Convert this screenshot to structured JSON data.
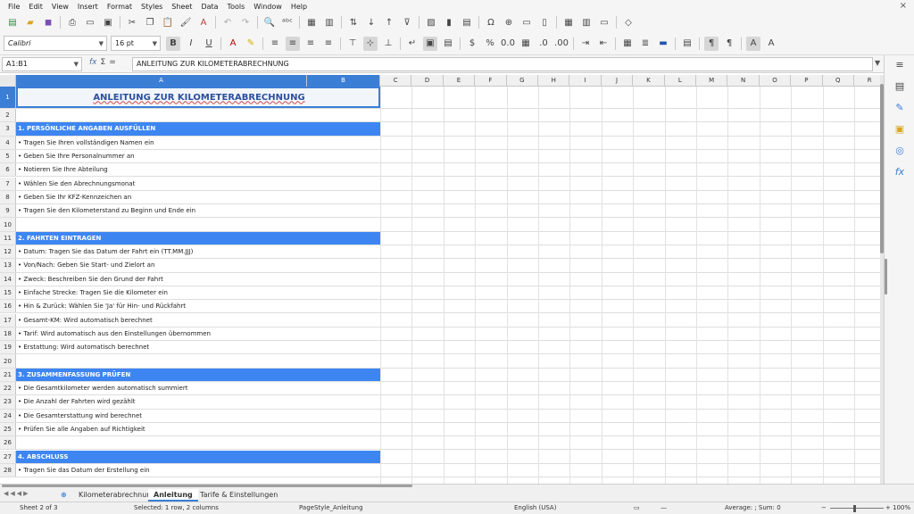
{
  "menu": [
    "File",
    "Edit",
    "View",
    "Insert",
    "Format",
    "Styles",
    "Sheet",
    "Data",
    "Tools",
    "Window",
    "Help"
  ],
  "format_toolbar": {
    "font_name": "Calibri",
    "font_size": "16 pt"
  },
  "formula_bar": {
    "name_box": "A1:B1",
    "content": "ANLEITUNG ZUR KILOMETERABRECHNUNG"
  },
  "columns": [
    "A",
    "B",
    "C",
    "D",
    "E",
    "F",
    "G",
    "H",
    "I",
    "J",
    "K",
    "L",
    "M",
    "N",
    "O",
    "P",
    "Q",
    "R"
  ],
  "rows": [
    {
      "n": "1",
      "text": "ANLEITUNG ZUR KILOMETERABRECHNUNG",
      "kind": "title"
    },
    {
      "n": "2",
      "text": "",
      "kind": "blank"
    },
    {
      "n": "3",
      "text": "1. PERSÖNLICHE ANGABEN AUSFÜLLEN",
      "kind": "section"
    },
    {
      "n": "4",
      "text": "• Tragen Sie Ihren vollständigen Namen ein",
      "kind": "item"
    },
    {
      "n": "5",
      "text": "• Geben Sie Ihre Personalnummer an",
      "kind": "item"
    },
    {
      "n": "6",
      "text": "• Notieren Sie Ihre Abteilung",
      "kind": "item"
    },
    {
      "n": "7",
      "text": "• Wählen Sie den Abrechnungsmonat",
      "kind": "item"
    },
    {
      "n": "8",
      "text": "• Geben Sie Ihr KFZ-Kennzeichen an",
      "kind": "item"
    },
    {
      "n": "9",
      "text": "• Tragen Sie den Kilometerstand zu Beginn und Ende ein",
      "kind": "item"
    },
    {
      "n": "10",
      "text": "",
      "kind": "blank"
    },
    {
      "n": "11",
      "text": "2. FAHRTEN EINTRAGEN",
      "kind": "section"
    },
    {
      "n": "12",
      "text": "• Datum: Tragen Sie das Datum der Fahrt ein (TT.MM.JJJ)",
      "kind": "item"
    },
    {
      "n": "13",
      "text": "• Von/Nach: Geben Sie Start- und Zielort an",
      "kind": "item"
    },
    {
      "n": "14",
      "text": "• Zweck: Beschreiben Sie den Grund der Fahrt",
      "kind": "item"
    },
    {
      "n": "15",
      "text": "• Einfache Strecke: Tragen Sie die Kilometer ein",
      "kind": "item"
    },
    {
      "n": "16",
      "text": "• Hin & Zurück: Wählen Sie 'Ja' für Hin- und Rückfahrt",
      "kind": "item"
    },
    {
      "n": "17",
      "text": "• Gesamt-KM: Wird automatisch berechnet",
      "kind": "item"
    },
    {
      "n": "18",
      "text": "• Tarif: Wird automatisch aus den Einstellungen übernommen",
      "kind": "item"
    },
    {
      "n": "19",
      "text": "• Erstattung: Wird automatisch berechnet",
      "kind": "item"
    },
    {
      "n": "20",
      "text": "",
      "kind": "blank"
    },
    {
      "n": "21",
      "text": "3. ZUSAMMENFASSUNG PRÜFEN",
      "kind": "section"
    },
    {
      "n": "22",
      "text": "• Die Gesamtkilometer werden automatisch summiert",
      "kind": "item"
    },
    {
      "n": "23",
      "text": "• Die Anzahl der Fahrten wird gezählt",
      "kind": "item"
    },
    {
      "n": "24",
      "text": "• Die Gesamterstattung wird berechnet",
      "kind": "item"
    },
    {
      "n": "25",
      "text": "• Prüfen Sie alle Angaben auf Richtigkeit",
      "kind": "item"
    },
    {
      "n": "26",
      "text": "",
      "kind": "blank"
    },
    {
      "n": "27",
      "text": "4. ABSCHLUSS",
      "kind": "section"
    },
    {
      "n": "28",
      "text": "• Tragen Sie das Datum der Erstellung ein",
      "kind": "item"
    }
  ],
  "tabs": {
    "add": "⊕",
    "items": [
      "Kilometerabrechnung",
      "Anleitung",
      "Tarife & Einstellungen"
    ],
    "active": "Anleitung"
  },
  "status": {
    "sheet": "Sheet 2 of 3",
    "selection": "Selected: 1 row, 2 columns",
    "page_style": "PageStyle_Anleitung",
    "language": "English (USA)",
    "summary": "Average: ; Sum: 0",
    "zoom": "100%"
  },
  "colors": {
    "accent": "#3b7ed6",
    "section_fill": "#3d86f2",
    "title_text": "#2c4f9e"
  }
}
